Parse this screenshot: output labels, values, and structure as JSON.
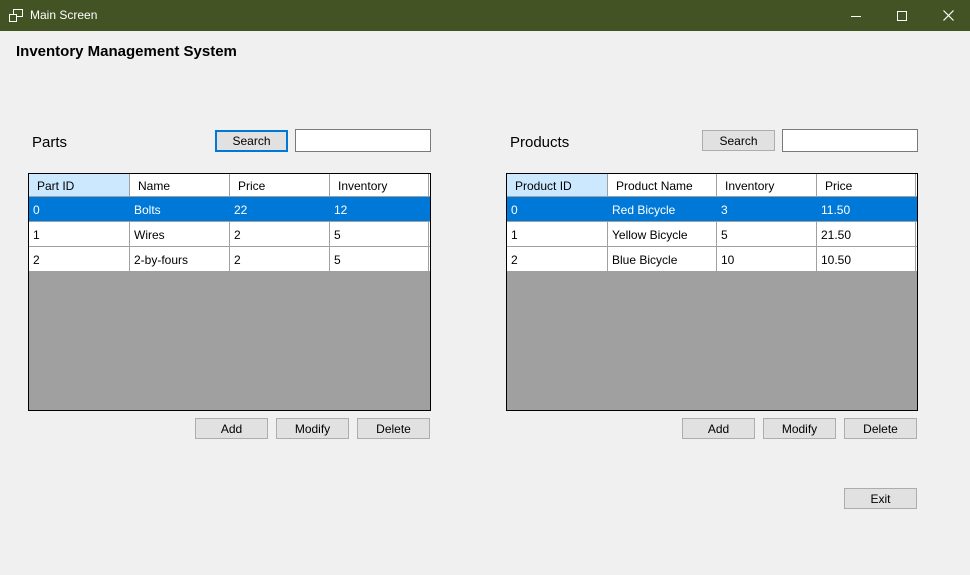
{
  "window": {
    "title": "Main Screen"
  },
  "app": {
    "heading": "Inventory Management System"
  },
  "parts": {
    "label": "Parts",
    "search_label": "Search",
    "search_value": "",
    "columns": [
      "Part ID",
      "Name",
      "Price",
      "Inventory"
    ],
    "rows": [
      [
        "0",
        "Bolts",
        "22",
        "12"
      ],
      [
        "1",
        "Wires",
        "2",
        "5"
      ],
      [
        "2",
        "2-by-fours",
        "2",
        "5"
      ]
    ],
    "add_label": "Add",
    "modify_label": "Modify",
    "delete_label": "Delete"
  },
  "products": {
    "label": "Products",
    "search_label": "Search",
    "search_value": "",
    "columns": [
      "Product ID",
      "Product Name",
      "Inventory",
      "Price"
    ],
    "rows": [
      [
        "0",
        "Red Bicycle",
        "3",
        "11.50"
      ],
      [
        "1",
        "Yellow Bicycle",
        "5",
        "21.50"
      ],
      [
        "2",
        "Blue Bicycle",
        "10",
        "10.50"
      ]
    ],
    "add_label": "Add",
    "modify_label": "Modify",
    "delete_label": "Delete"
  },
  "exit_label": "Exit",
  "colors": {
    "titlebar": "#435324",
    "selection": "#0078d7",
    "header_selected": "#cce8ff",
    "grid_empty": "#a0a0a0"
  },
  "icons": [
    "app-icon",
    "minimize-icon",
    "maximize-icon",
    "close-icon"
  ]
}
